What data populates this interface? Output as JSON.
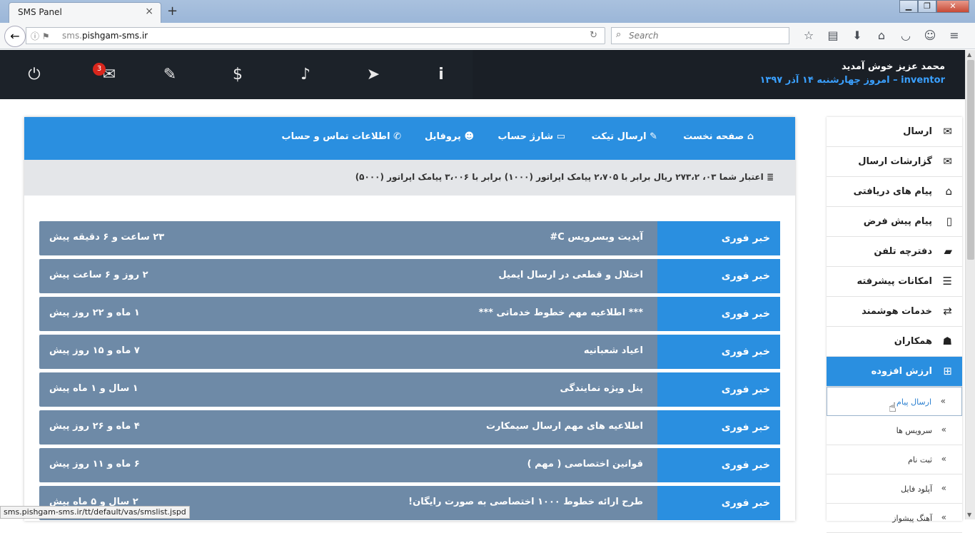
{
  "browser": {
    "tab_title": "SMS Panel",
    "tab_close": "×",
    "tab_new": "+",
    "win_minimize": "▁",
    "win_restore": "❐",
    "win_close": "✕",
    "url_host_prefix": "sms.",
    "url_host_main": "pishgam-sms.ir",
    "search_placeholder": "Search",
    "status_url": "sms.pishgam-sms.ir/tt/default/vas/smslist.jspd",
    "toolbar_icons": [
      "star-icon",
      "reader-icon",
      "download-icon",
      "home-icon",
      "pocket-icon",
      "account-icon",
      "menu-icon"
    ]
  },
  "header": {
    "welcome": "محمد عزیز خوش آمدید",
    "user": "inventor",
    "date": "– امروز چهارشنبه ۱۴ آذر ۱۳۹۷",
    "mail_count": "3"
  },
  "panel_nav": {
    "home": "صفحه نخست",
    "ticket": "ارسال تیکت",
    "charge": "شارژ حساب",
    "profile": "پروفایل",
    "contact": "اطلاعات تماس و حساب"
  },
  "credit": "اعتبار شما ۰۳، ۲۷۳،۲ ریال برابر با ۲،۷۰۵ پیامک اپراتور (۱۰۰۰) برابر با ۳،۰۰۶ پیامک اپراتور (۵۰۰۰)",
  "news": [
    {
      "tag": "خبر فوری",
      "title": "آپدیت وبسرویس C#",
      "time": "۲۳ ساعت و ۶ دقیقه پیش"
    },
    {
      "tag": "خبر فوری",
      "title": "اختلال و قطعی در ارسال ایمیل",
      "time": "۲ روز و ۶ ساعت پیش"
    },
    {
      "tag": "خبر فوری",
      "title": "*** اطلاعیه مهم خطوط خدماتی ***",
      "time": "۱ ماه و ۲۲ روز پیش"
    },
    {
      "tag": "خبر فوری",
      "title": "اعیاد شعبانیه",
      "time": "۷ ماه و ۱۵ روز پیش"
    },
    {
      "tag": "خبر فوری",
      "title": "پنل ویژه نمایندگی",
      "time": "۱ سال و ۱ ماه پیش"
    },
    {
      "tag": "خبر فوری",
      "title": "اطلاعیه های مهم ارسال سیمکارت",
      "time": "۴ ماه و ۲۶ روز پیش"
    },
    {
      "tag": "خبر فوری",
      "title": "قوانین اختصاصی ( مهم )",
      "time": "۶ ماه و ۱۱ روز پیش"
    },
    {
      "tag": "خبر فوری",
      "title": "طرح ارائه خطوط ۱۰۰۰ اختصاصی به صورت رایگان!",
      "time": "۲ سال و ۵ ماه پیش"
    }
  ],
  "sidebar": {
    "items": [
      {
        "label": "ارسال",
        "icon": "✉"
      },
      {
        "label": "گزارشات ارسال",
        "icon": "✉"
      },
      {
        "label": "پیام های دریافتی",
        "icon": "⌂"
      },
      {
        "label": "پیام پیش فرض",
        "icon": "▯"
      },
      {
        "label": "دفترچه تلفن",
        "icon": "▰"
      },
      {
        "label": "امکانات پیشرفته",
        "icon": "☰"
      },
      {
        "label": "خدمات هوشمند",
        "icon": "⇄"
      },
      {
        "label": "همکاران",
        "icon": "☗"
      },
      {
        "label": "ارزش افزوده",
        "icon": "⊞"
      }
    ],
    "sub_items": [
      "ارسال پیام",
      "سرویس ها",
      "ثبت نام",
      "آپلود فایل",
      "آهنگ پیشواز"
    ]
  }
}
